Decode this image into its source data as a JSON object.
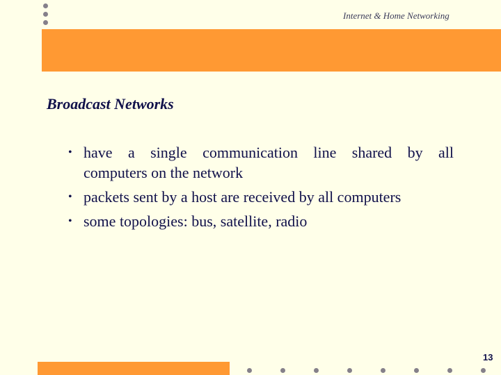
{
  "header": {
    "title": "Internet & Home Networking"
  },
  "slide": {
    "title": "Broadcast Networks",
    "bullets": [
      {
        "line1": "have a single communication line shared by all",
        "line2": "computers on the network"
      },
      {
        "text": "packets sent by a host are received by all computers"
      },
      {
        "text": "some topologies: bus, satellite, radio"
      }
    ],
    "bullet_glyph": "•"
  },
  "footer": {
    "page_number": "13"
  },
  "colors": {
    "background": "#FFFFE9",
    "accent_orange": "#FF9933",
    "dot_gray": "#85808a",
    "text_navy": "#10104a"
  }
}
